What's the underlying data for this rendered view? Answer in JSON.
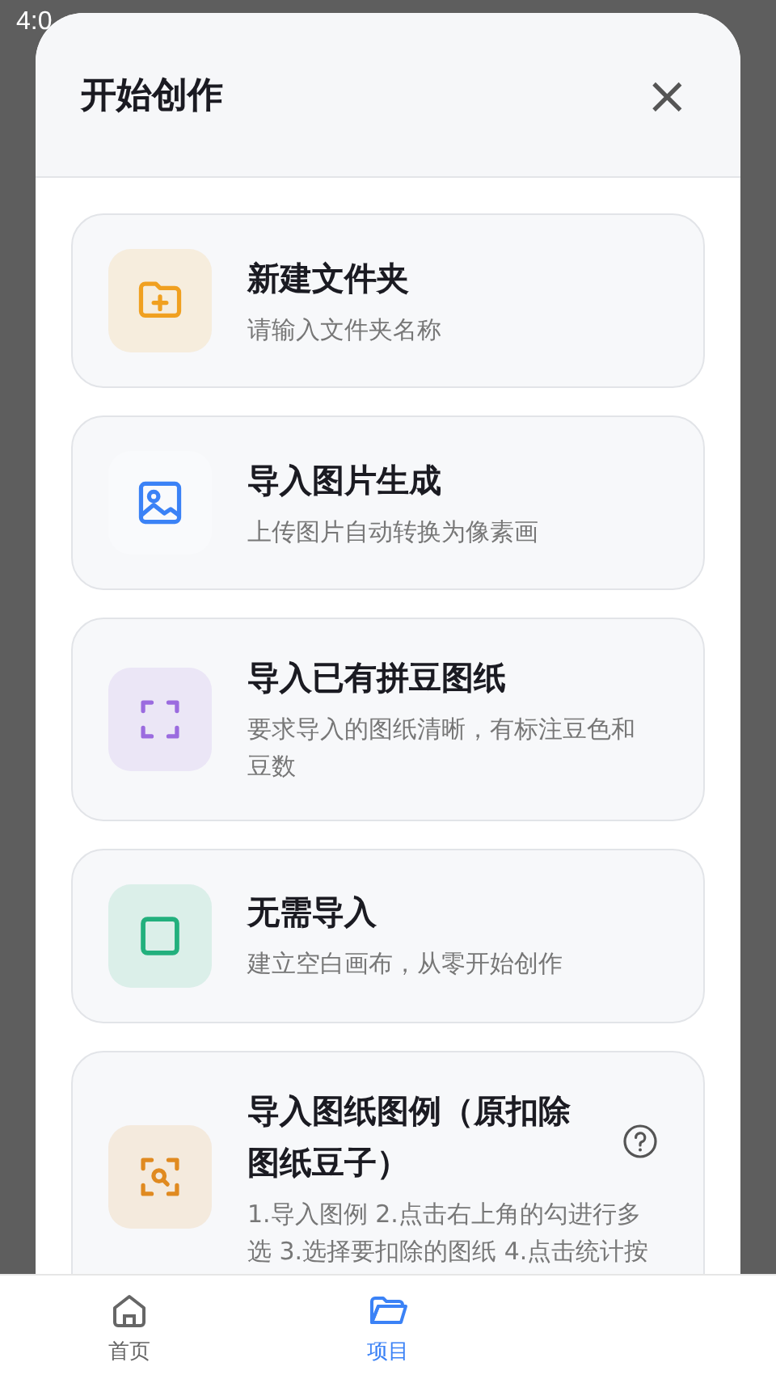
{
  "status_bar": {
    "time": "4:0"
  },
  "sheet": {
    "title": "开始创作",
    "close": "×"
  },
  "cards": [
    {
      "title": "新建文件夹",
      "description": "请输入文件夹名称",
      "kind": "folder-plus",
      "color": "#f0a020",
      "help": false
    },
    {
      "title": "导入图片生成",
      "description": "上传图片自动转换为像素画",
      "kind": "image",
      "color": "#3b82f6",
      "help": false
    },
    {
      "title": "导入已有拼豆图纸",
      "description": "要求导入的图纸清晰，有标注豆色和豆数",
      "kind": "scan",
      "color": "#9b6bdf",
      "help": false
    },
    {
      "title": "无需导入",
      "description": "建立空白画布，从零开始创作",
      "kind": "square",
      "color": "#22b07d",
      "help": false
    },
    {
      "title": "导入图纸图例（原扣除图纸豆子）",
      "description": "1.导入图例 2.点击右上角的勾进行多选 3.选择要扣除的图纸 4.点击统计按",
      "kind": "scan-search",
      "color": "#e08a20",
      "help": true
    }
  ],
  "bottom_nav": [
    {
      "label": "首页",
      "kind": "home",
      "selected": false
    },
    {
      "label": "项目",
      "kind": "folder",
      "selected": true
    }
  ]
}
